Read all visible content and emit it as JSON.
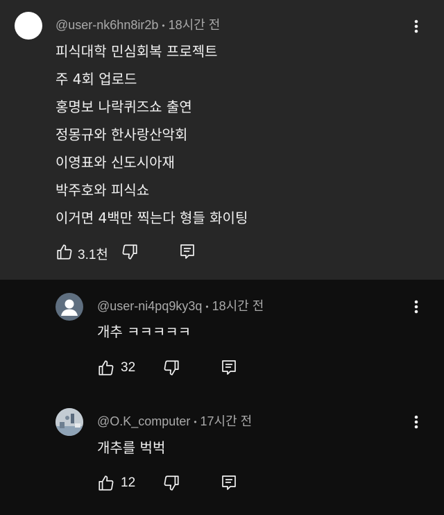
{
  "comments": [
    {
      "author": "@user-nk6hn8ir2b",
      "time": "18시간 전",
      "lines": [
        "피식대학 민심회복 프로젝트",
        "주 4회 업로드",
        "홍명보 나락퀴즈쇼 출연",
        "정몽규와 한사랑산악회",
        "이영표와 신도시아재",
        "박주호와 피식쇼",
        "이거면 4백만 찍는다 형들 화이팅"
      ],
      "likes": "3.1천"
    }
  ],
  "replies": [
    {
      "author": "@user-ni4pq9ky3q",
      "time": "18시간 전",
      "text": "개추 ㅋㅋㅋㅋㅋ",
      "likes": "32"
    },
    {
      "author": "@O.K_computer",
      "time": "17시간 전",
      "text": "개추를 벅벅",
      "likes": "12"
    }
  ],
  "icons": {
    "like": "thumb-up-icon",
    "dislike": "thumb-down-icon",
    "reply": "reply-comment-icon",
    "more": "more-vert-icon"
  },
  "colors": {
    "highlight_bg": "#272727",
    "page_bg": "#0f0f0f",
    "meta_text": "#aaaaaa",
    "text": "#f1f1f1"
  }
}
